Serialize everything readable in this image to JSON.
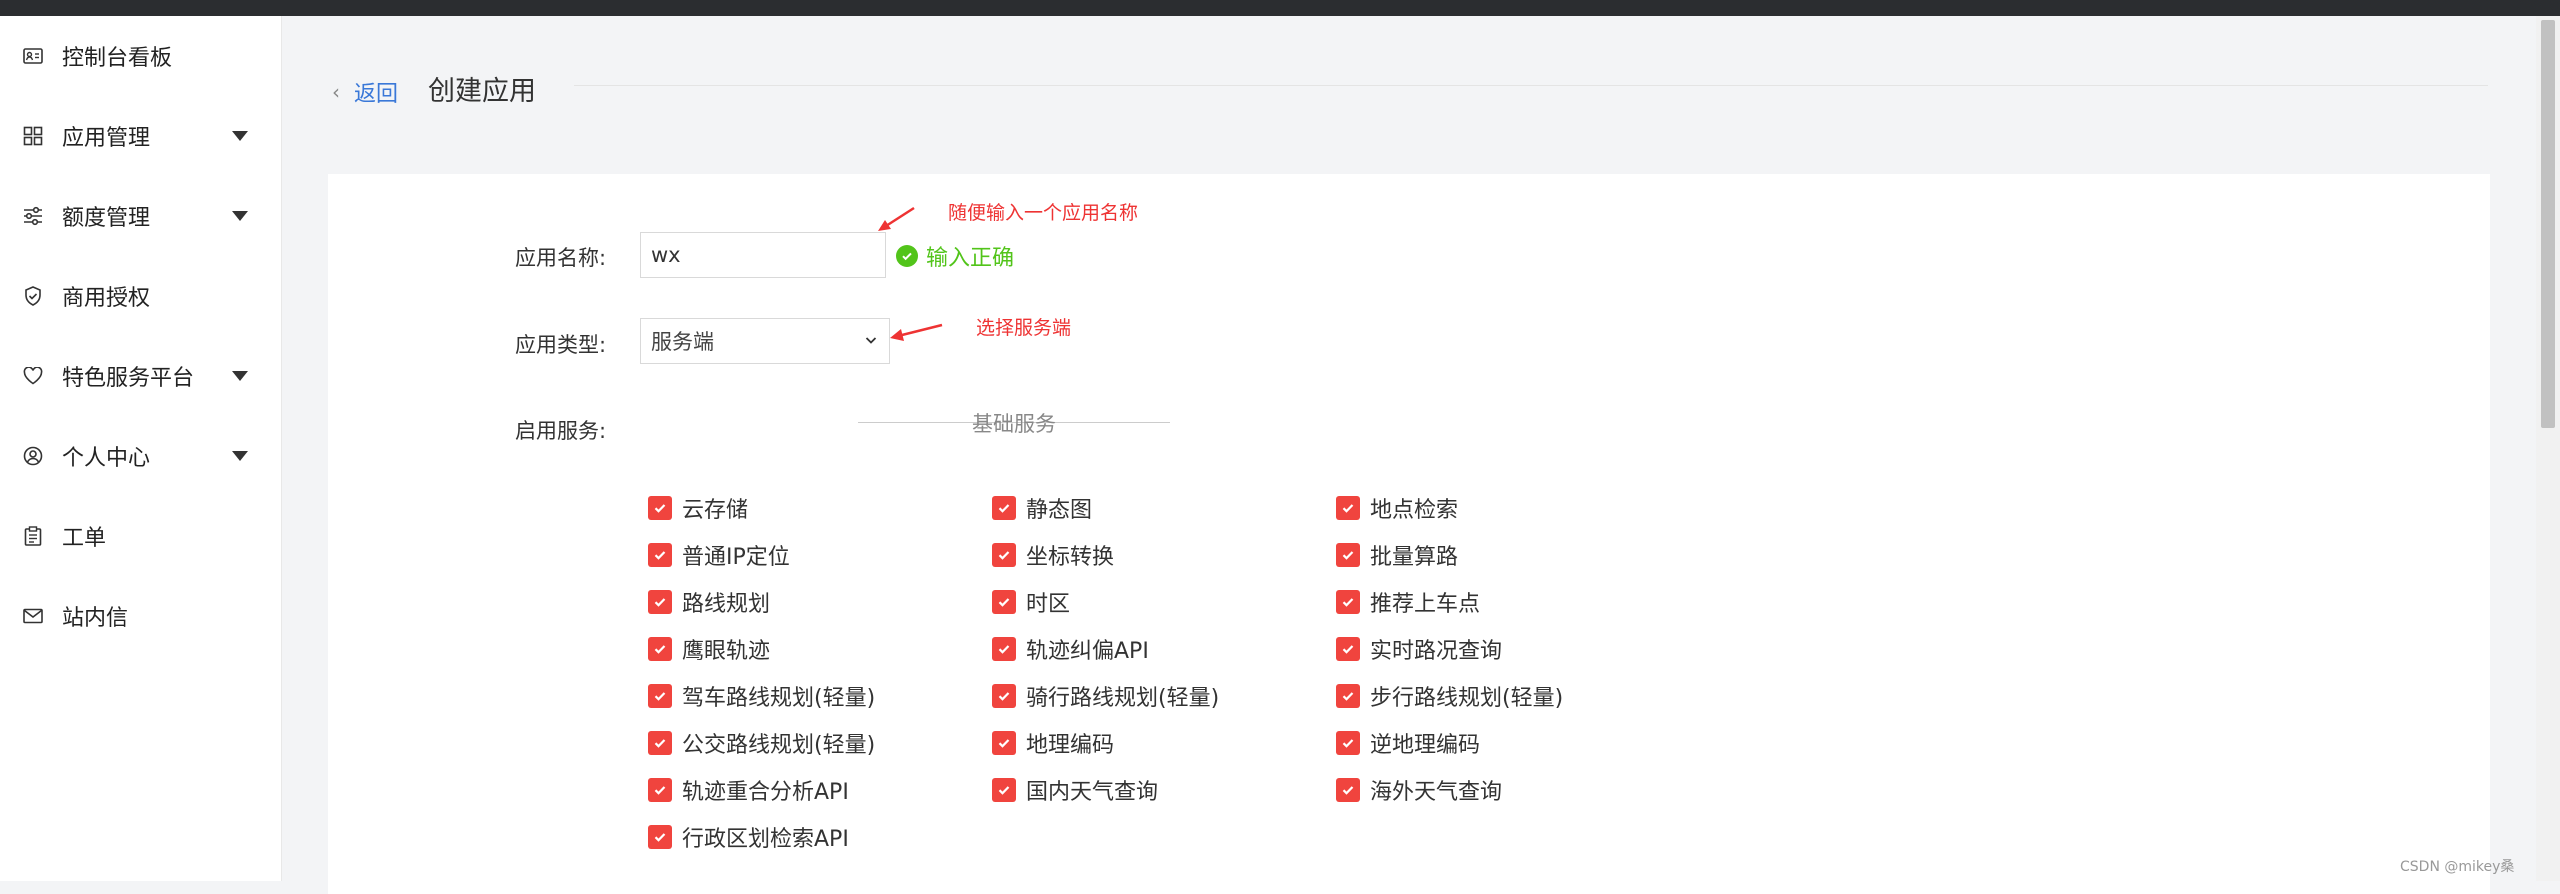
{
  "sidebar": {
    "items": [
      {
        "label": "控制台看板",
        "icon": "id-card-icon",
        "caret": false
      },
      {
        "label": "应用管理",
        "icon": "grid-icon",
        "caret": true
      },
      {
        "label": "额度管理",
        "icon": "sliders-icon",
        "caret": true
      },
      {
        "label": "商用授权",
        "icon": "shield-icon",
        "caret": false
      },
      {
        "label": "特色服务平台",
        "icon": "heart-icon",
        "caret": true
      },
      {
        "label": "个人中心",
        "icon": "user-circle-icon",
        "caret": true
      },
      {
        "label": "工单",
        "icon": "clipboard-icon",
        "caret": false
      },
      {
        "label": "站内信",
        "icon": "mail-icon",
        "caret": false
      }
    ]
  },
  "header": {
    "back_label": "返回",
    "title": "创建应用"
  },
  "form": {
    "name_label": "应用名称:",
    "name_value": "wx",
    "name_valid_text": "输入正确",
    "type_label": "应用类型:",
    "type_value": "服务端",
    "services_label": "启用服务:",
    "services_group_title": "基础服务"
  },
  "annotations": {
    "name_hint": "随便输入一个应用名称",
    "type_hint": "选择服务端"
  },
  "services": [
    {
      "label": "云存储",
      "checked": true
    },
    {
      "label": "静态图",
      "checked": true
    },
    {
      "label": "地点检索",
      "checked": true
    },
    {
      "label": "普通IP定位",
      "checked": true
    },
    {
      "label": "坐标转换",
      "checked": true
    },
    {
      "label": "批量算路",
      "checked": true
    },
    {
      "label": "路线规划",
      "checked": true
    },
    {
      "label": "时区",
      "checked": true
    },
    {
      "label": "推荐上车点",
      "checked": true
    },
    {
      "label": "鹰眼轨迹",
      "checked": true
    },
    {
      "label": "轨迹纠偏API",
      "checked": true
    },
    {
      "label": "实时路况查询",
      "checked": true
    },
    {
      "label": "驾车路线规划(轻量)",
      "checked": true
    },
    {
      "label": "骑行路线规划(轻量)",
      "checked": true
    },
    {
      "label": "步行路线规划(轻量)",
      "checked": true
    },
    {
      "label": "公交路线规划(轻量)",
      "checked": true
    },
    {
      "label": "地理编码",
      "checked": true
    },
    {
      "label": "逆地理编码",
      "checked": true
    },
    {
      "label": "轨迹重合分析API",
      "checked": true
    },
    {
      "label": "国内天气查询",
      "checked": true
    },
    {
      "label": "海外天气查询",
      "checked": true
    },
    {
      "label": "行政区划检索API",
      "checked": true
    }
  ],
  "colors": {
    "accent_link": "#3a78d8",
    "success": "#52c41a",
    "checkbox": "#f0443e",
    "annotation": "#ee3333"
  },
  "watermark": "CSDN @mikey桑"
}
